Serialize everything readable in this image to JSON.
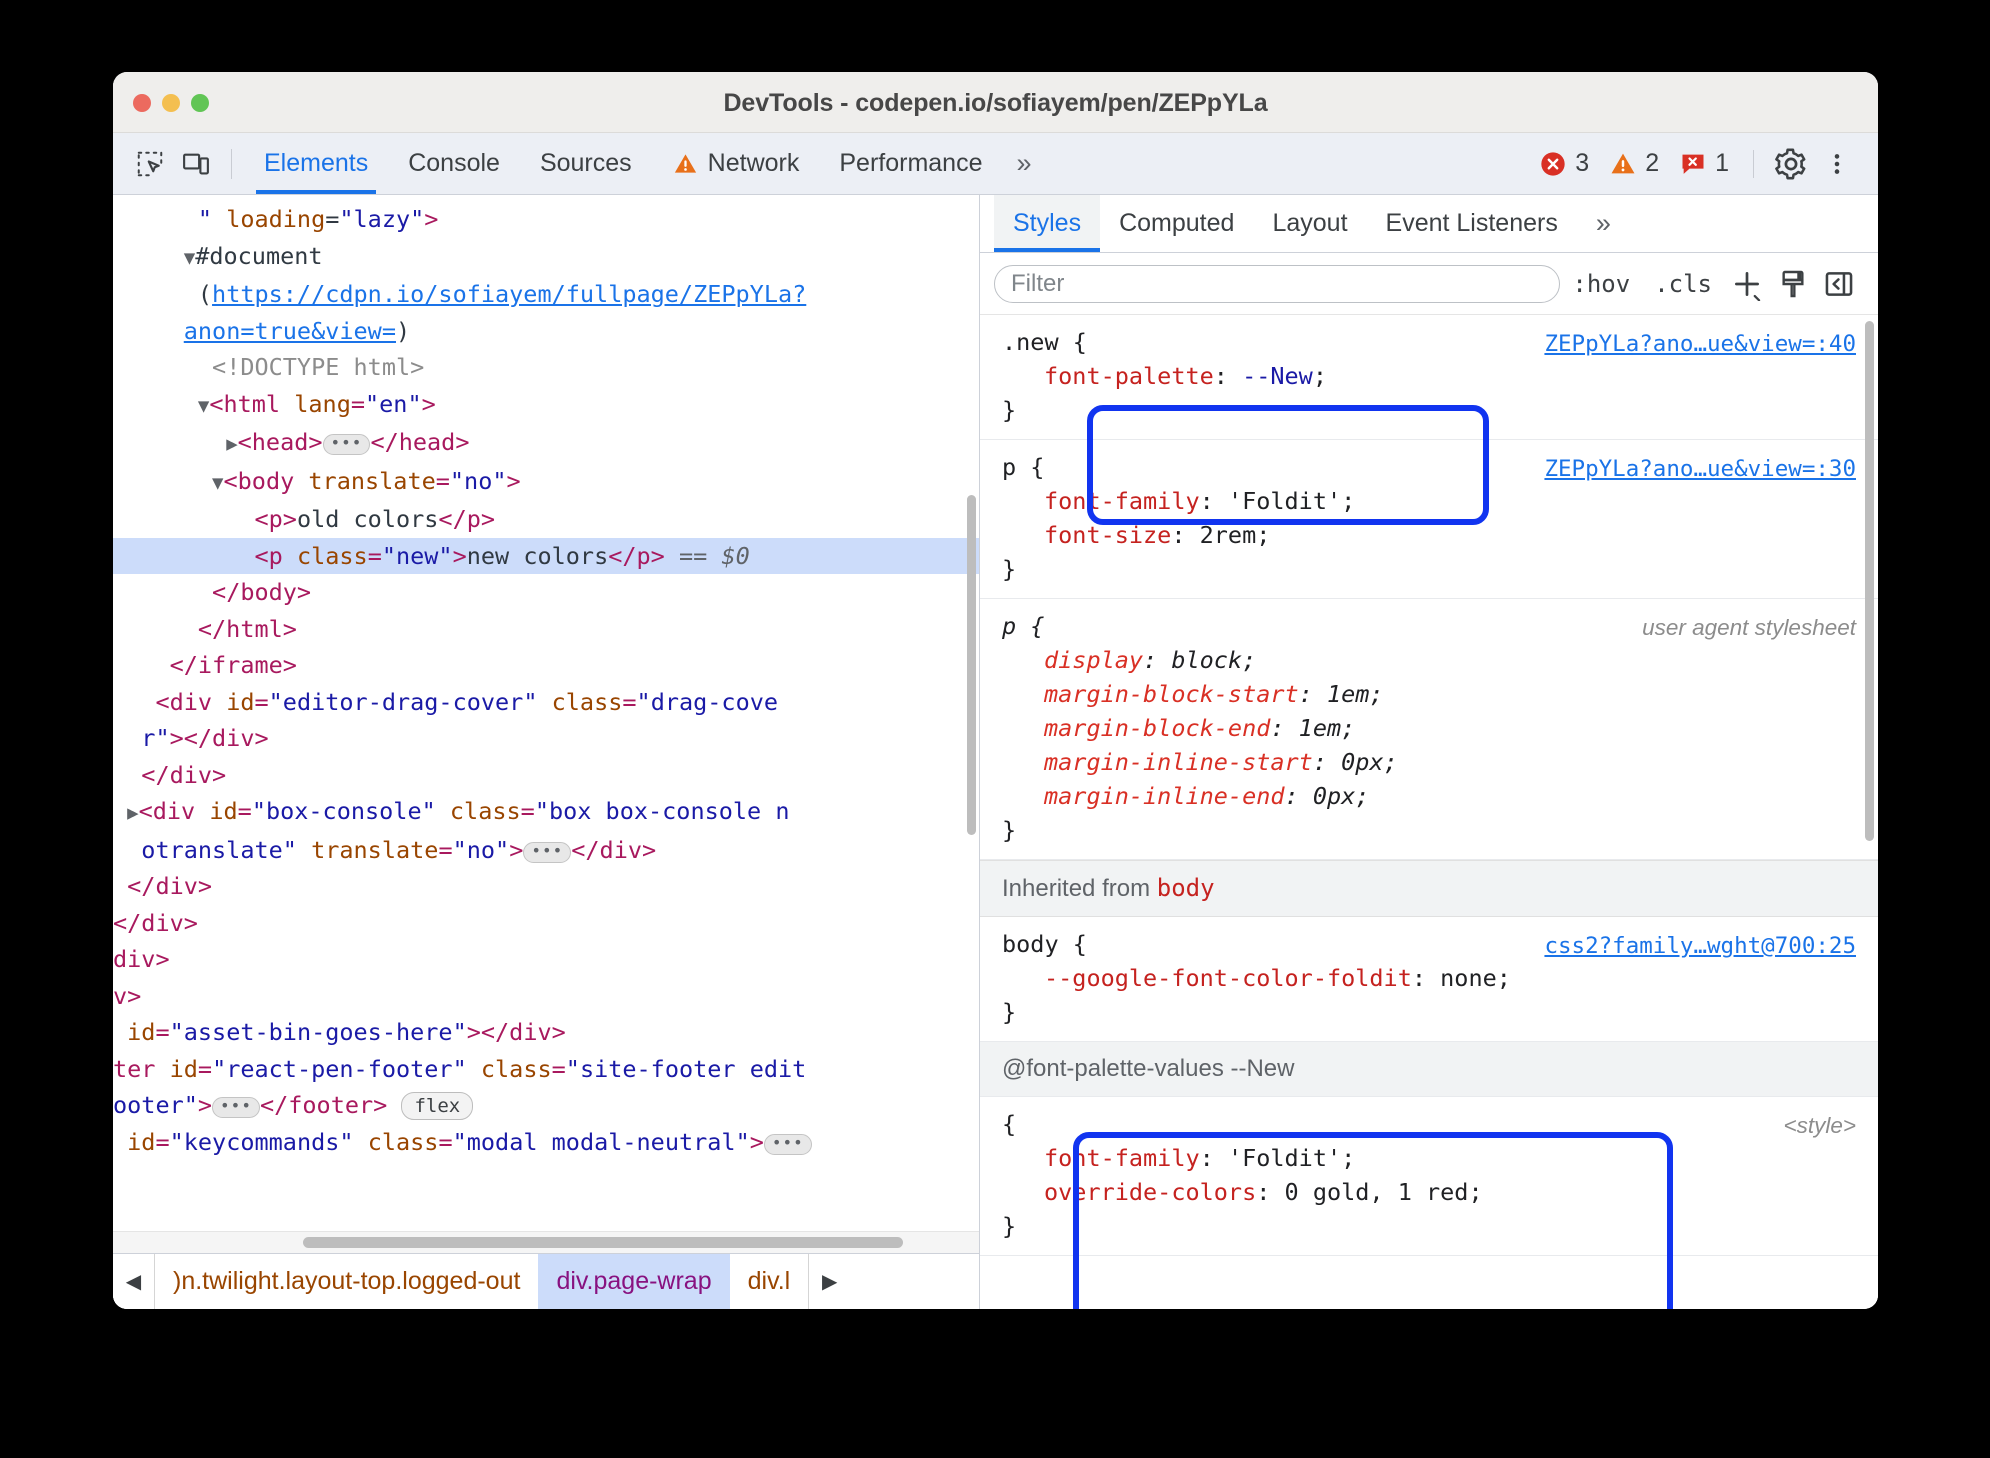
{
  "window": {
    "title": "DevTools - codepen.io/sofiayem/pen/ZEPpYLa",
    "traffic_lights": [
      "close",
      "minimize",
      "zoom"
    ]
  },
  "toolbar": {
    "inspect_icon": "inspect-element-icon",
    "device_icon": "device-toolbar-icon",
    "tabs": [
      {
        "label": "Elements",
        "active": true,
        "icon": null
      },
      {
        "label": "Console",
        "active": false,
        "icon": null
      },
      {
        "label": "Sources",
        "active": false,
        "icon": null
      },
      {
        "label": "Network",
        "active": false,
        "icon": "warning-triangle-icon"
      },
      {
        "label": "Performance",
        "active": false,
        "icon": null
      }
    ],
    "more_tabs": "»",
    "counters": {
      "errors": "3",
      "warnings": "2",
      "issues": "1"
    },
    "settings_icon": "gear-icon",
    "more_icon": "kebab-menu-icon"
  },
  "dom_tree": {
    "lines": [
      "\" loading=\"lazy\">",
      "#document",
      "(https://cdpn.io/sofiayem/fullpage/ZEPpYLa?anon=true&view=)",
      "<!DOCTYPE html>",
      "<html lang=\"en\">",
      "<head>…</head>",
      "<body translate=\"no\">",
      "<p>old colors</p>",
      "<p class=\"new\">new colors</p> == $0",
      "</body>",
      "</html>",
      "</iframe>",
      "<div id=\"editor-drag-cover\" class=\"drag-cover\"></div>",
      "</div>",
      "<div id=\"box-console\" class=\"box box-console notranslate\" translate=\"no\">…</div>",
      "</div>",
      "</div>",
      "div>",
      "v>",
      "id=\"asset-bin-goes-here\"></div>",
      "ter id=\"react-pen-footer\" class=\"site-footer editooter\">…</footer>",
      "id=\"keycommands\" class=\"modal modal-neutral\">…"
    ],
    "selected_line": "<p class=\"new\">new colors</p> == $0",
    "selected_marker": "$0",
    "flex_badge": "flex",
    "document_url": "https://cdpn.io/sofiayem/fullpage/ZEPpYLa?anon=true&view=",
    "doc_url_part1": "https://cdpn.io/sofiayem/fullpage/ZEPpYLa?",
    "doc_url_part2": "anon=true&view=",
    "doctype": "<!DOCTYPE html>"
  },
  "breadcrumb": {
    "scroll_left": "◀",
    "scroll_right": "▶",
    "items": [
      {
        "label": ")n.twilight.layout-top.logged-out",
        "active": false
      },
      {
        "label": "div.page-wrap",
        "active": true
      },
      {
        "label": "div.l",
        "active": false
      }
    ]
  },
  "styles_pane": {
    "tabs": [
      {
        "label": "Styles",
        "active": true
      },
      {
        "label": "Computed",
        "active": false
      },
      {
        "label": "Layout",
        "active": false
      },
      {
        "label": "Event Listeners",
        "active": false
      }
    ],
    "more_tabs": "»",
    "filter": {
      "placeholder": "Filter",
      "value": ""
    },
    "hov_button": ":hov",
    "cls_button": ".cls",
    "new_rule_icon": "plus-icon",
    "copy_styles_icon": "paintbrush-icon",
    "toggle_sidebar_icon": "sidebar-toggle-icon",
    "rules": [
      {
        "selector": ".new {",
        "close": "}",
        "source": "ZEPpYLa?ano…ue&view=:40",
        "source_kind": "link",
        "highlighted": true,
        "declarations": [
          {
            "prop": "font-palette",
            "value": "--New",
            "value_kind": "var"
          }
        ]
      },
      {
        "selector": "p {",
        "close": "}",
        "source": "ZEPpYLa?ano…ue&view=:30",
        "source_kind": "link",
        "highlighted": false,
        "declarations": [
          {
            "prop": "font-family",
            "value": "'Foldit'",
            "value_kind": "plain"
          },
          {
            "prop": "font-size",
            "value": "2rem",
            "value_kind": "plain"
          }
        ]
      },
      {
        "selector": "p {",
        "close": "}",
        "source": "user agent stylesheet",
        "source_kind": "ua",
        "highlighted": false,
        "italic": true,
        "declarations": [
          {
            "prop": "display",
            "value": "block",
            "value_kind": "plain"
          },
          {
            "prop": "margin-block-start",
            "value": "1em",
            "value_kind": "plain"
          },
          {
            "prop": "margin-block-end",
            "value": "1em",
            "value_kind": "plain"
          },
          {
            "prop": "margin-inline-start",
            "value": "0px",
            "value_kind": "plain"
          },
          {
            "prop": "margin-inline-end",
            "value": "0px",
            "value_kind": "plain"
          }
        ]
      }
    ],
    "inherited_header": {
      "prefix": "Inherited from",
      "element": "body"
    },
    "inherited_rule": {
      "selector": "body {",
      "close": "}",
      "source": "css2?family…wght@700:25",
      "declarations": [
        {
          "prop": "--google-font-color-foldit",
          "value": "none"
        }
      ]
    },
    "at_rule": {
      "header": "@font-palette-values --New",
      "open": "{",
      "close": "}",
      "source": "<style>",
      "declarations": [
        {
          "prop": "font-family",
          "value": "'Foldit'"
        },
        {
          "prop": "override-colors",
          "value": "0 gold, 1 red"
        }
      ]
    }
  },
  "annotations": {
    "highlight_color": "#1134f0",
    "rings": [
      "new-rule-ring",
      "font-palette-values-ring"
    ]
  }
}
